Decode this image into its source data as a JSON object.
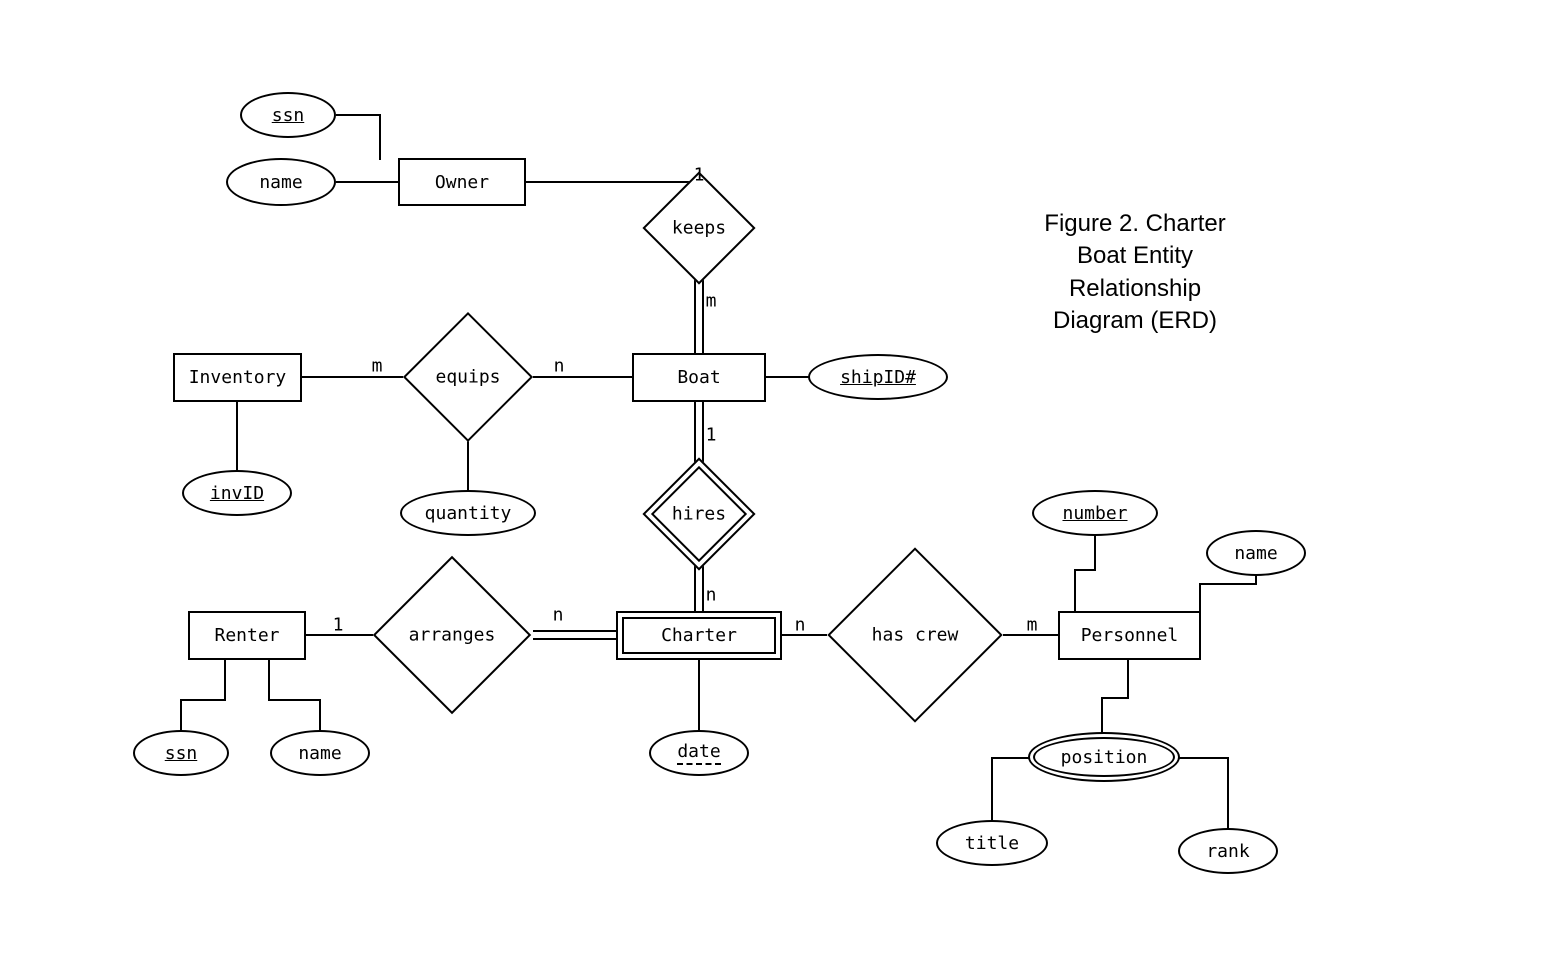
{
  "caption": {
    "line1": "Figure 2. Charter",
    "line2": "Boat Entity",
    "line3": "Relationship",
    "line4": "Diagram (ERD)"
  },
  "entities": {
    "owner": "Owner",
    "inventory": "Inventory",
    "boat": "Boat",
    "renter": "Renter",
    "charter": "Charter",
    "personnel": "Personnel"
  },
  "relationships": {
    "keeps": "keeps",
    "equips": "equips",
    "hires": "hires",
    "arranges": "arranges",
    "hasCrew": "has crew"
  },
  "attributes": {
    "ownerSsn": "ssn",
    "ownerName": "name",
    "invID": "invID",
    "quantity": "quantity",
    "shipID": "shipID#",
    "renterSsn": "ssn",
    "renterName": "name",
    "date": "date",
    "number": "number",
    "personnelName": "name",
    "position": "position",
    "title": "title",
    "rank": "rank"
  },
  "cardinalities": {
    "keeps_owner": "1",
    "keeps_boat": "m",
    "equips_inventory": "m",
    "equips_boat": "n",
    "hires_boat": "1",
    "hires_charter": "n",
    "arranges_renter": "1",
    "arranges_charter": "n",
    "hascrew_charter": "n",
    "hascrew_personnel": "m"
  }
}
